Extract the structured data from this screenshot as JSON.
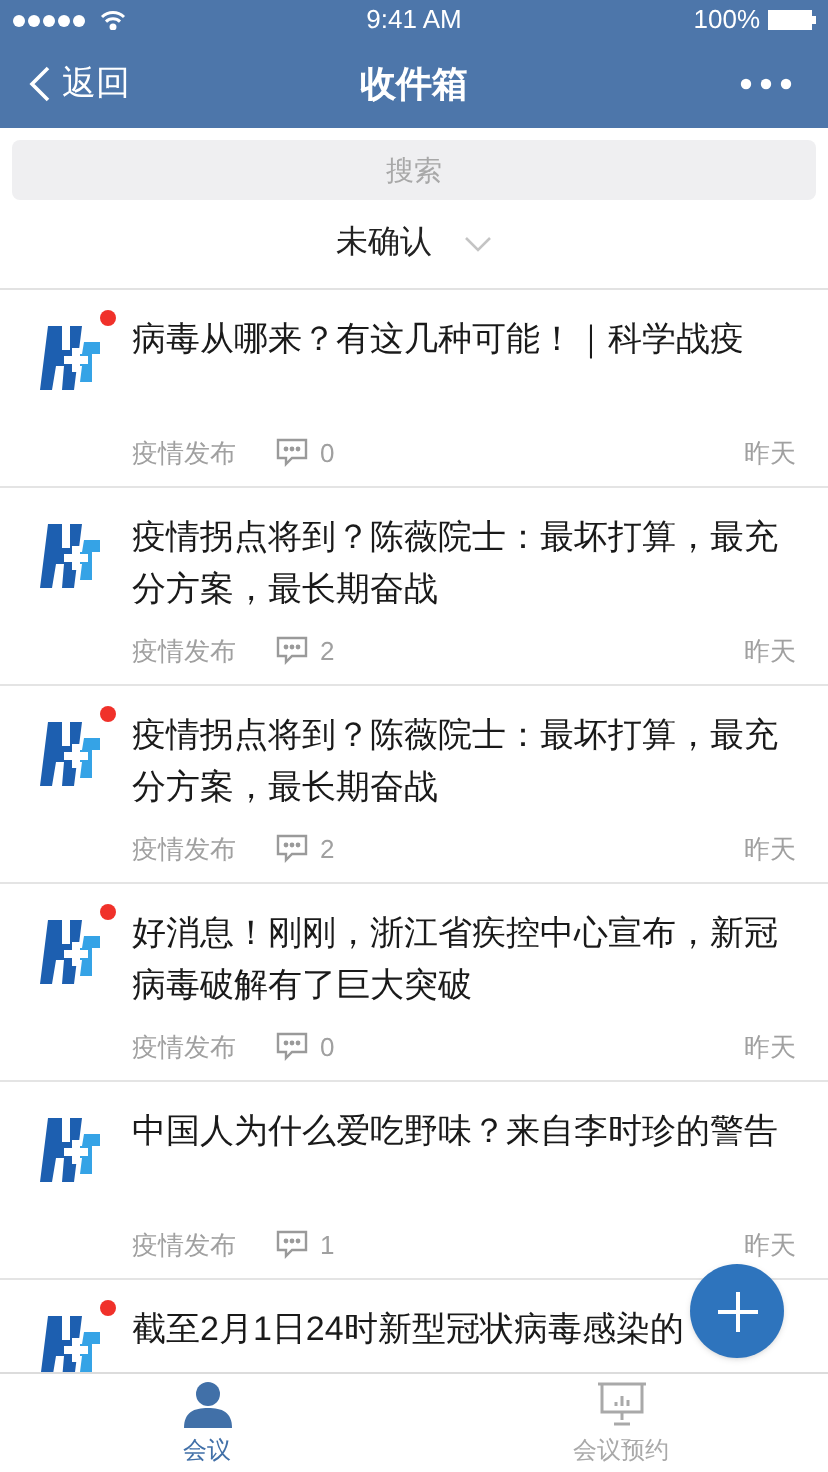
{
  "status_bar": {
    "time": "9:41 AM",
    "battery": "100%"
  },
  "nav": {
    "back": "返回",
    "title": "收件箱"
  },
  "search": {
    "placeholder": "搜索"
  },
  "filter": {
    "label": "未确认"
  },
  "messages": [
    {
      "title": "病毒从哪来？有这几种可能！｜科学战疫",
      "source": "疫情发布",
      "comments": "0",
      "time": "昨天",
      "unread": true
    },
    {
      "title": "疫情拐点将到？陈薇院士：最坏打算，最充分方案，最长期奋战",
      "source": "疫情发布",
      "comments": "2",
      "time": "昨天",
      "unread": false
    },
    {
      "title": "疫情拐点将到？陈薇院士：最坏打算，最充分方案，最长期奋战",
      "source": "疫情发布",
      "comments": "2",
      "time": "昨天",
      "unread": true
    },
    {
      "title": "好消息！刚刚，浙江省疾控中心宣布，新冠病毒破解有了巨大突破",
      "source": "疫情发布",
      "comments": "0",
      "time": "昨天",
      "unread": true
    },
    {
      "title": "中国人为什么爱吃野味？来自李时珍的警告",
      "source": "疫情发布",
      "comments": "1",
      "time": "昨天",
      "unread": false
    },
    {
      "title": "截至2月1日24时新型冠状病毒感染的",
      "unread": true
    }
  ],
  "tabs": [
    {
      "label": "会议",
      "selected": true,
      "kind": "person"
    },
    {
      "label": "会议预约",
      "selected": false,
      "kind": "board"
    }
  ]
}
